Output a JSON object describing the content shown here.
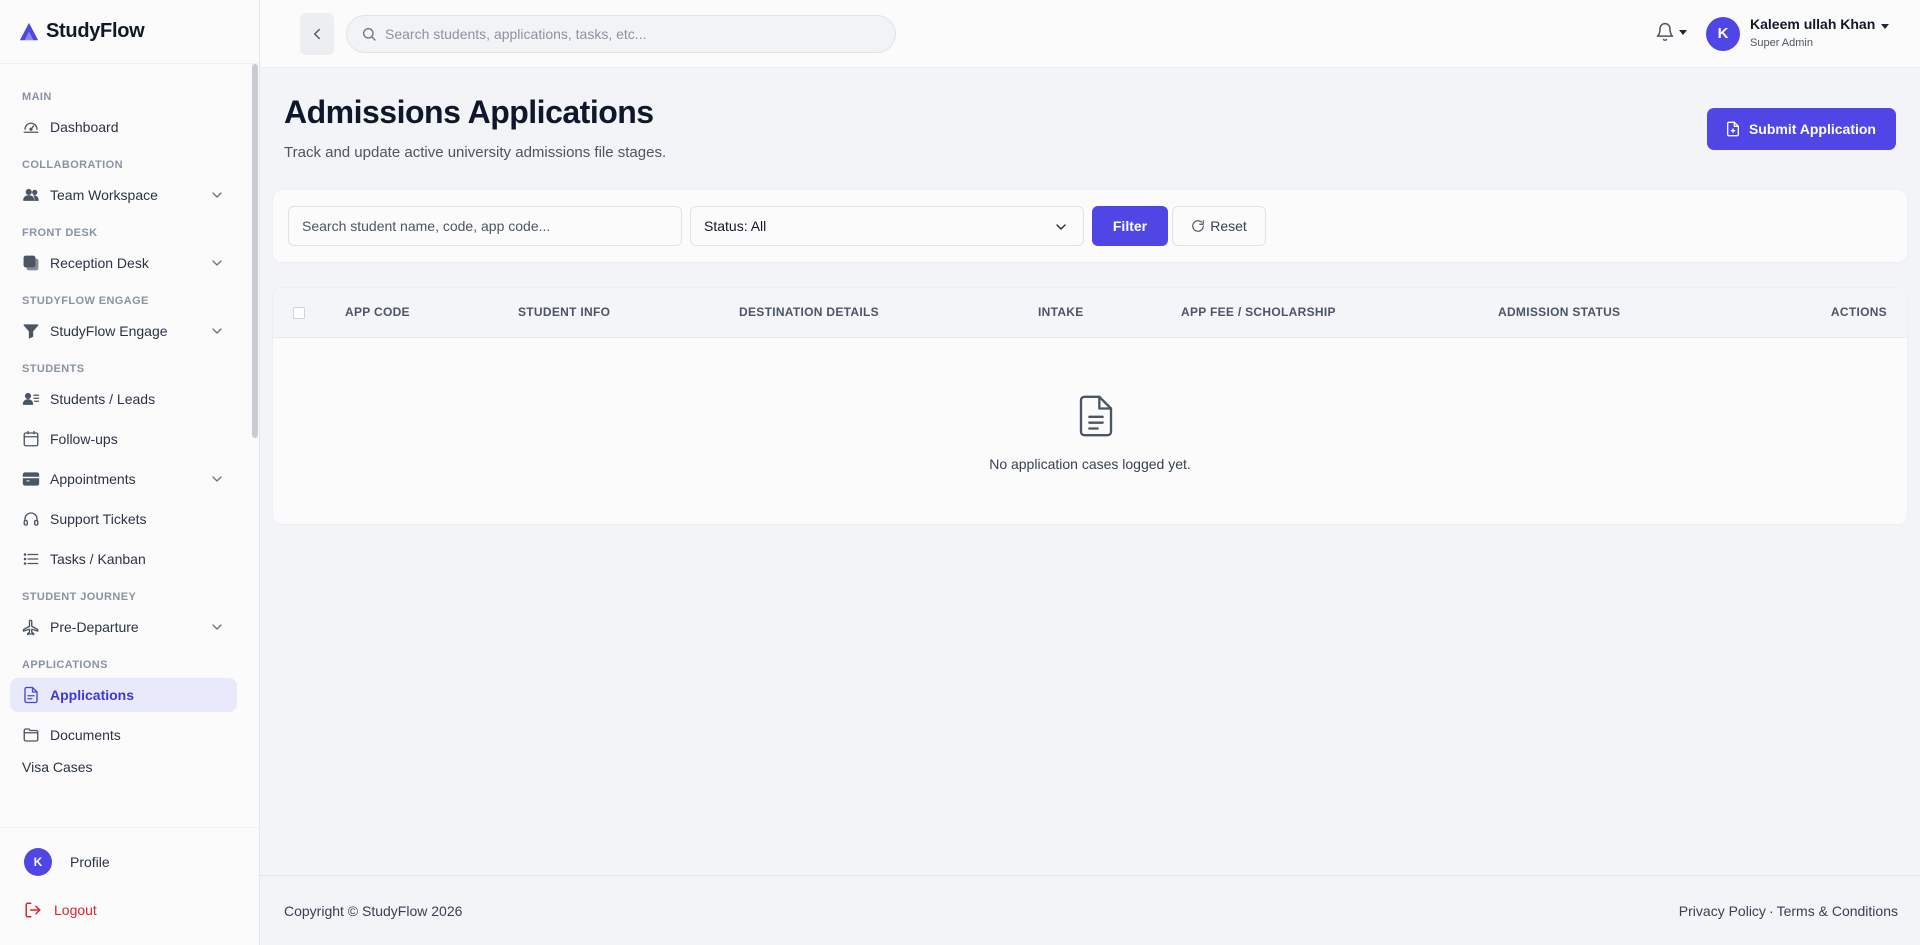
{
  "brand": {
    "name": "StudyFlow"
  },
  "sidebar": {
    "sections": [
      {
        "label": "MAIN",
        "items": [
          {
            "label": "Dashboard",
            "icon": "dashboard-gauge-icon",
            "expandable": false,
            "active": false
          }
        ]
      },
      {
        "label": "COLLABORATION",
        "items": [
          {
            "label": "Team Workspace",
            "icon": "users-icon",
            "expandable": true,
            "active": false
          }
        ]
      },
      {
        "label": "FRONT DESK",
        "items": [
          {
            "label": "Reception Desk",
            "icon": "reception-icon",
            "expandable": true,
            "active": false
          }
        ]
      },
      {
        "label": "STUDYFLOW ENGAGE",
        "items": [
          {
            "label": "StudyFlow Engage",
            "icon": "funnel-icon",
            "expandable": true,
            "active": false
          }
        ]
      },
      {
        "label": "STUDENTS",
        "items": [
          {
            "label": "Students / Leads",
            "icon": "user-list-icon",
            "expandable": false,
            "active": false
          },
          {
            "label": "Follow-ups",
            "icon": "calendar-icon",
            "expandable": false,
            "active": false
          },
          {
            "label": "Appointments",
            "icon": "card-icon",
            "expandable": true,
            "active": false
          },
          {
            "label": "Support Tickets",
            "icon": "headset-icon",
            "expandable": false,
            "active": false
          },
          {
            "label": "Tasks / Kanban",
            "icon": "list-icon",
            "expandable": false,
            "active": false
          }
        ]
      },
      {
        "label": "STUDENT JOURNEY",
        "items": [
          {
            "label": "Pre-Departure",
            "icon": "plane-icon",
            "expandable": true,
            "active": false
          }
        ]
      },
      {
        "label": "APPLICATIONS",
        "items": [
          {
            "label": "Applications",
            "icon": "document-icon",
            "expandable": false,
            "active": true
          },
          {
            "label": "Documents",
            "icon": "folder-icon",
            "expandable": false,
            "active": false
          }
        ]
      }
    ],
    "partial_item": "Visa Cases",
    "profile_label": "Profile",
    "profile_initial": "K",
    "logout_label": "Logout"
  },
  "topbar": {
    "search_placeholder": "Search students, applications, tasks, etc...",
    "user": {
      "initial": "K",
      "name": "Kaleem ullah Khan",
      "role": "Super Admin"
    }
  },
  "page": {
    "title": "Admissions Applications",
    "subtitle": "Track and update active university admissions file stages.",
    "submit_label": "Submit Application"
  },
  "filters": {
    "search_placeholder": "Search student name, code, app code...",
    "status_value": "Status: All",
    "filter_label": "Filter",
    "reset_label": "Reset"
  },
  "table": {
    "columns": [
      "APP CODE",
      "STUDENT INFO",
      "DESTINATION DETAILS",
      "INTAKE",
      "APP FEE / SCHOLARSHIP",
      "ADMISSION STATUS",
      "ACTIONS"
    ],
    "empty_message": "No application cases logged yet."
  },
  "footer": {
    "copyright": "Copyright © StudyFlow 2026",
    "privacy": "Privacy Policy",
    "separator": "·",
    "terms": "Terms & Conditions"
  },
  "colors": {
    "accent": "#4f46e5",
    "danger": "#dc2626",
    "active_bg": "#e8eafb"
  }
}
